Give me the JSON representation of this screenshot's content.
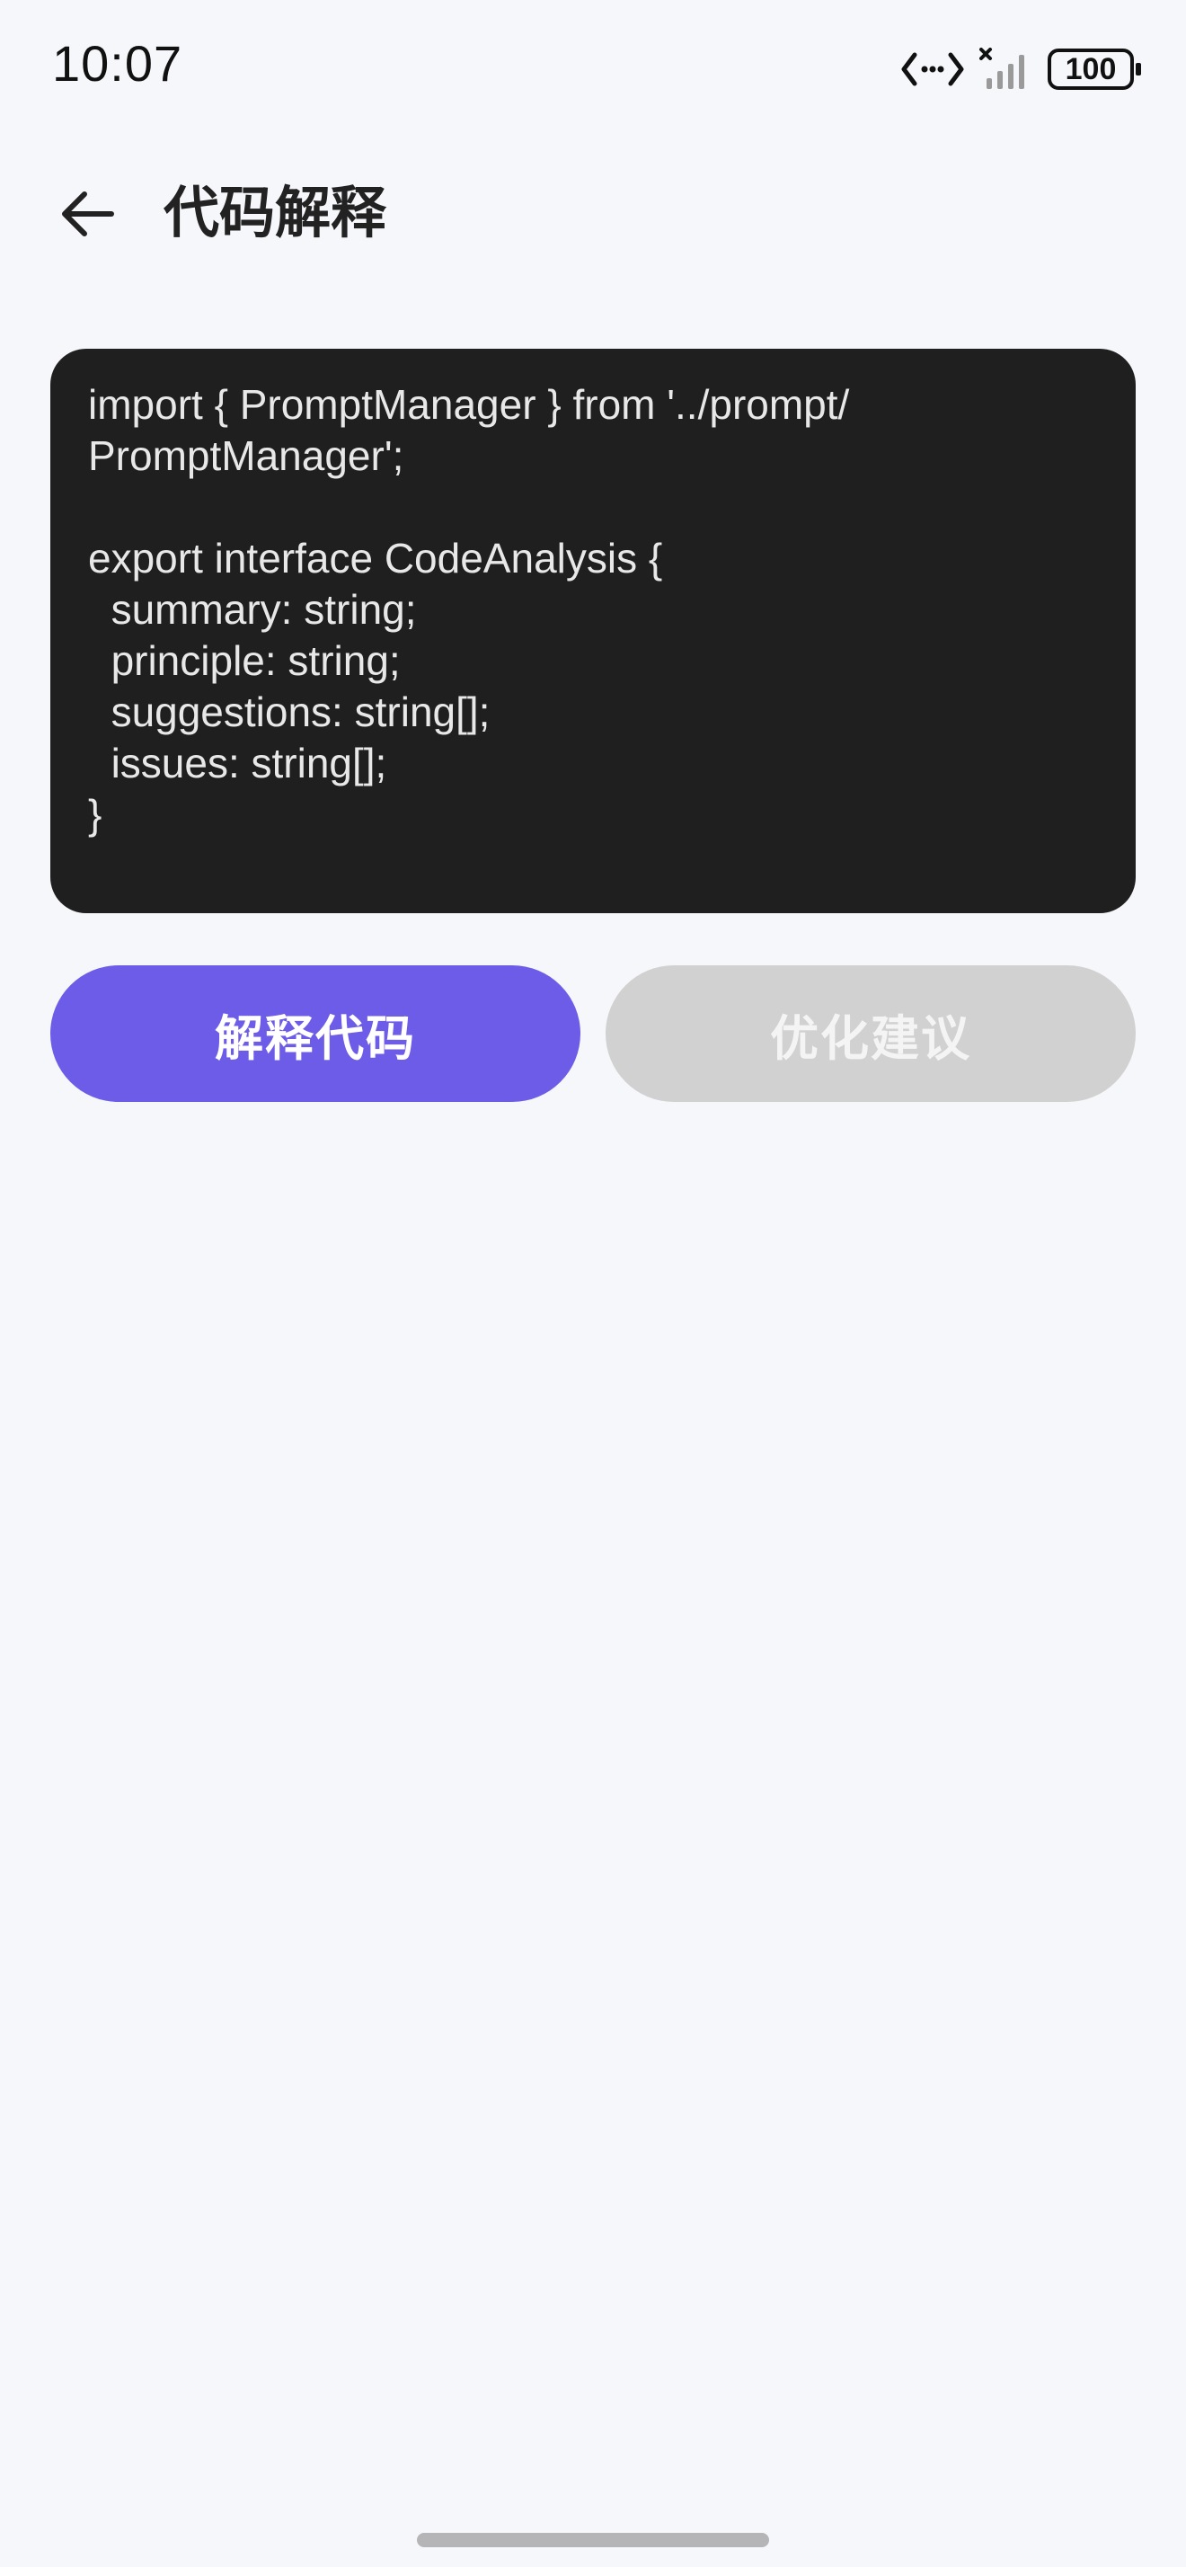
{
  "status_bar": {
    "time": "10:07",
    "battery": "100",
    "icons": [
      "data-transfer-icon",
      "signal-no-service-icon",
      "battery-icon"
    ]
  },
  "header": {
    "title": "代码解释",
    "back_icon": "arrow-left-icon"
  },
  "code_editor": {
    "content": "import { PromptManager } from '../prompt/\nPromptManager';\n\nexport interface CodeAnalysis {\n  summary: string;\n  principle: string;\n  suggestions: string[];\n  issues: string[];\n}"
  },
  "actions": {
    "explain_label": "解释代码",
    "optimize_label": "优化建议"
  },
  "colors": {
    "background": "#f5f7fa",
    "code_background": "#1f1f20",
    "primary_button": "#6c5ce7",
    "disabled_button": "#d1d1d1"
  }
}
